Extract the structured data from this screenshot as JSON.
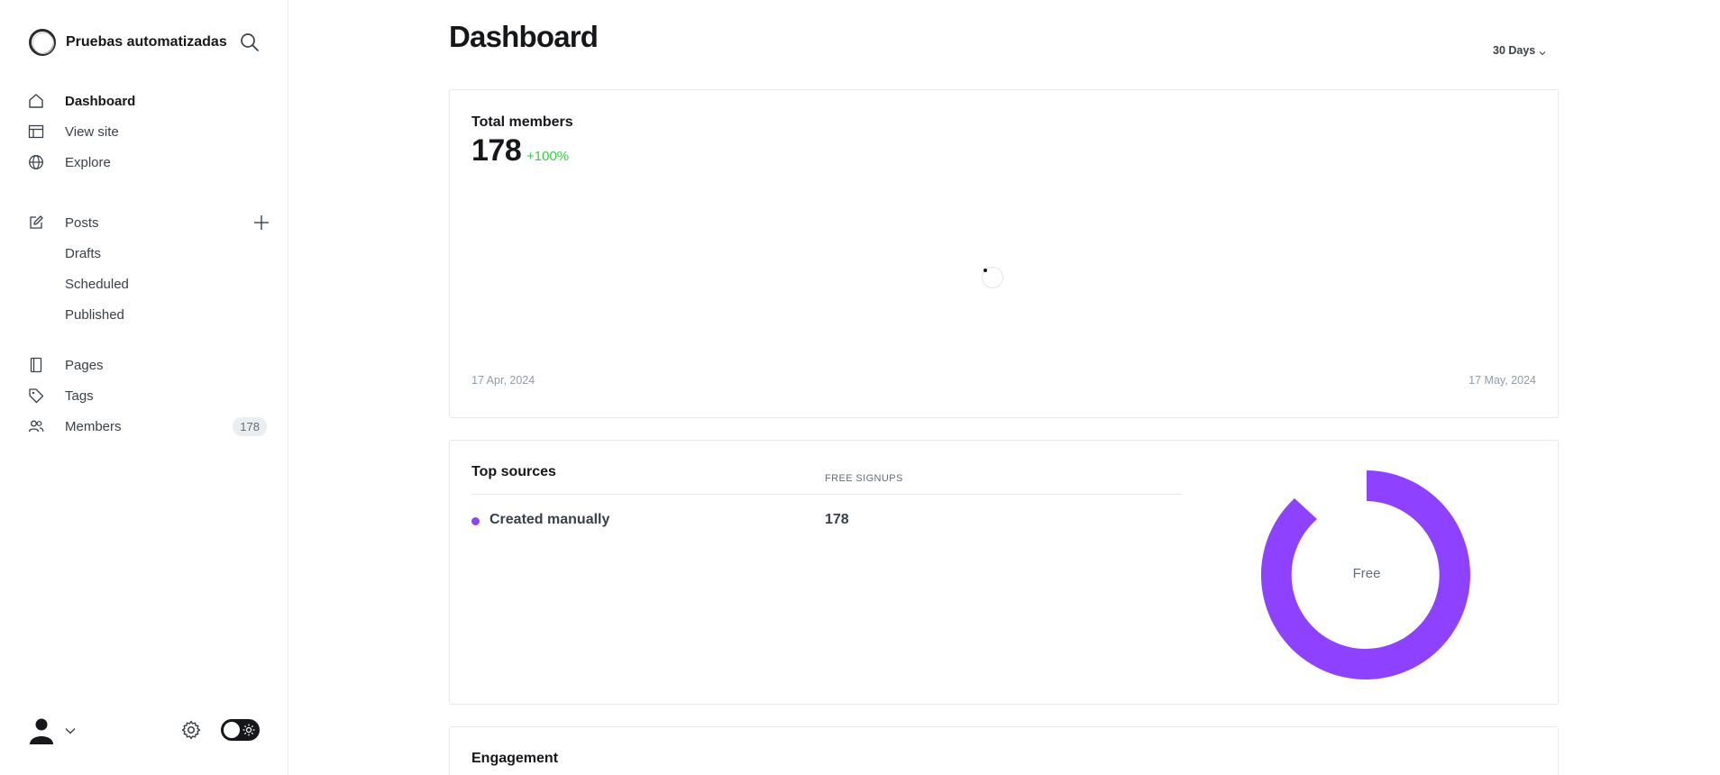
{
  "sidebar": {
    "site_name": "Pruebas automatizadas",
    "nav_primary": [
      {
        "label": "Dashboard",
        "icon": "home-icon",
        "active": true
      },
      {
        "label": "View site",
        "icon": "layout-icon",
        "active": false
      },
      {
        "label": "Explore",
        "icon": "globe-icon",
        "active": false
      }
    ],
    "posts": {
      "label": "Posts",
      "icon": "pen-icon",
      "sub": [
        "Drafts",
        "Scheduled",
        "Published"
      ]
    },
    "nav_secondary": [
      {
        "label": "Pages",
        "icon": "page-icon"
      },
      {
        "label": "Tags",
        "icon": "tag-icon"
      },
      {
        "label": "Members",
        "icon": "members-icon",
        "count": "178"
      }
    ]
  },
  "main": {
    "title": "Dashboard",
    "range": "30 Days",
    "total_members": {
      "title": "Total members",
      "value": "178",
      "change": "+100%",
      "start_date": "17 Apr, 2024",
      "end_date": "17 May, 2024"
    },
    "top_sources": {
      "title": "Top sources",
      "column_header": "FREE SIGNUPS",
      "rows": [
        {
          "name": "Created manually",
          "value": "178",
          "color": "#8e42ff"
        }
      ],
      "donut_label": "Free"
    },
    "engagement": {
      "title": "Engagement"
    }
  },
  "colors": {
    "accent": "#8e42ff",
    "positive": "#30cf43",
    "text": "#15171a"
  }
}
